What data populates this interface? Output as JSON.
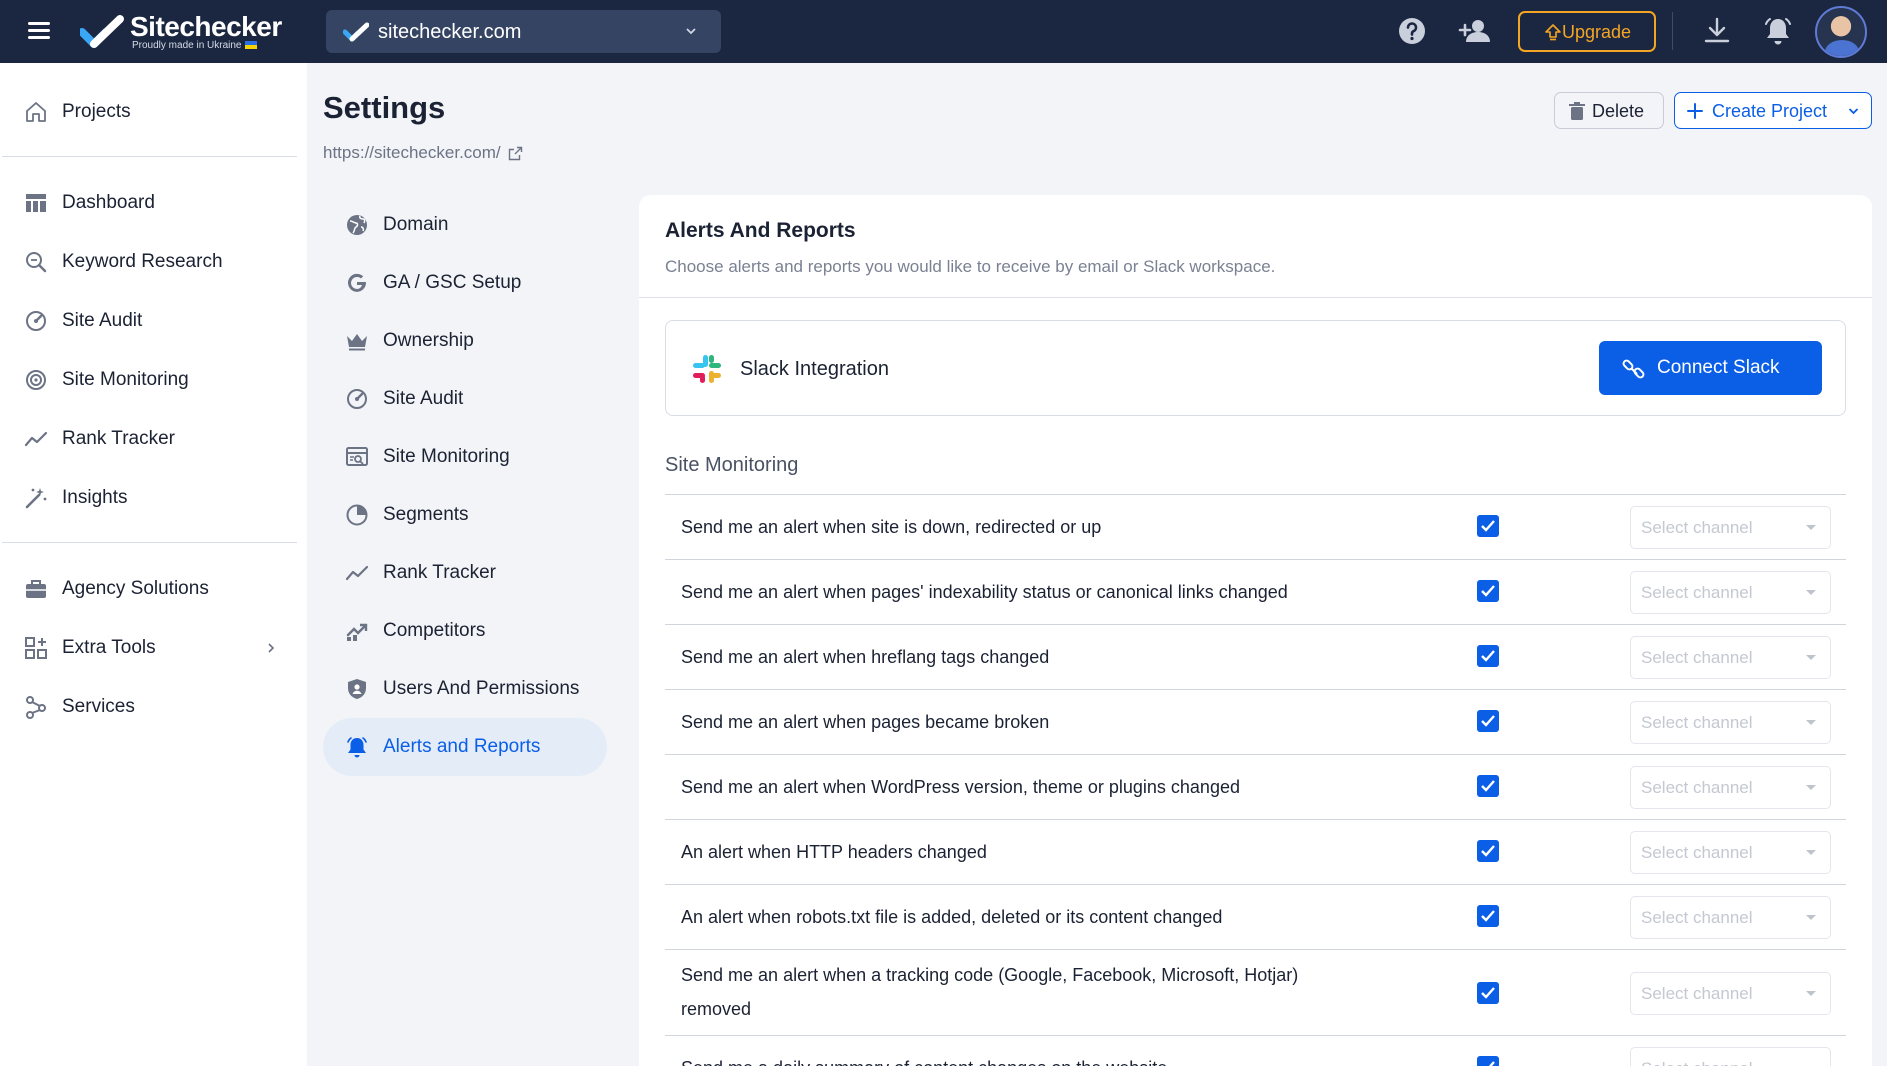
{
  "app": {
    "name": "Sitechecker",
    "tagline": "Proudly made in Ukraine",
    "site": "sitechecker.com",
    "upgrade_label": "Upgrade",
    "colors": {
      "brand_blue": "#0b5ee6",
      "topbar": "#1b2740",
      "upgrade": "#f5a524"
    }
  },
  "sidebar": {
    "items": [
      {
        "label": "Projects",
        "icon": "home-icon"
      },
      {
        "label": "Dashboard",
        "icon": "dashboard-icon"
      },
      {
        "label": "Keyword Research",
        "icon": "keyword-research-icon"
      },
      {
        "label": "Site Audit",
        "icon": "site-audit-icon"
      },
      {
        "label": "Site Monitoring",
        "icon": "site-monitoring-icon"
      },
      {
        "label": "Rank Tracker",
        "icon": "rank-tracker-icon"
      },
      {
        "label": "Insights",
        "icon": "magic-wand-icon"
      },
      {
        "label": "Agency Solutions",
        "icon": "briefcase-icon"
      },
      {
        "label": "Extra Tools",
        "icon": "extra-tools-icon"
      },
      {
        "label": "Services",
        "icon": "services-icon"
      }
    ]
  },
  "page": {
    "title": "Settings",
    "url": "https://sitechecker.com/",
    "delete_label": "Delete",
    "create_label": "Create Project"
  },
  "settings_menu": {
    "items": [
      {
        "label": "Domain",
        "icon": "globe-icon"
      },
      {
        "label": "GA / GSC Setup",
        "icon": "google-icon"
      },
      {
        "label": "Ownership",
        "icon": "crown-icon"
      },
      {
        "label": "Site Audit",
        "icon": "site-audit-icon"
      },
      {
        "label": "Site Monitoring",
        "icon": "site-monitoring-icon"
      },
      {
        "label": "Segments",
        "icon": "pie-icon"
      },
      {
        "label": "Rank Tracker",
        "icon": "rank-tracker-icon"
      },
      {
        "label": "Competitors",
        "icon": "competitors-icon"
      },
      {
        "label": "Users And Permissions",
        "icon": "shield-user-icon"
      },
      {
        "label": "Alerts and Reports",
        "icon": "bell-icon",
        "active": true
      }
    ]
  },
  "panel": {
    "title": "Alerts And Reports",
    "subtitle": "Choose alerts and reports you would like to receive by email or Slack workspace.",
    "slack": {
      "name": "Slack Integration",
      "button": "Connect Slack"
    },
    "section": "Site Monitoring",
    "channel_placeholder": "Select channel",
    "alerts": [
      {
        "label": "Send me an alert when site is down, redirected or up",
        "checked": true
      },
      {
        "label": "Send me an alert when pages' indexability status or canonical links changed",
        "checked": true
      },
      {
        "label": "Send me an alert when hreflang tags changed",
        "checked": true
      },
      {
        "label": "Send me an alert when pages became broken",
        "checked": true
      },
      {
        "label": "Send me an alert when WordPress version, theme or plugins changed",
        "checked": true
      },
      {
        "label": "An alert when HTTP headers changed",
        "checked": true
      },
      {
        "label": "An alert when robots.txt file is added, deleted or its content changed",
        "checked": true
      },
      {
        "label": "Send me an alert when a tracking code (Google, Facebook, Microsoft, Hotjar) removed",
        "checked": true
      },
      {
        "label": "Send me a daily summary of content changes on the website",
        "checked": true
      }
    ]
  }
}
